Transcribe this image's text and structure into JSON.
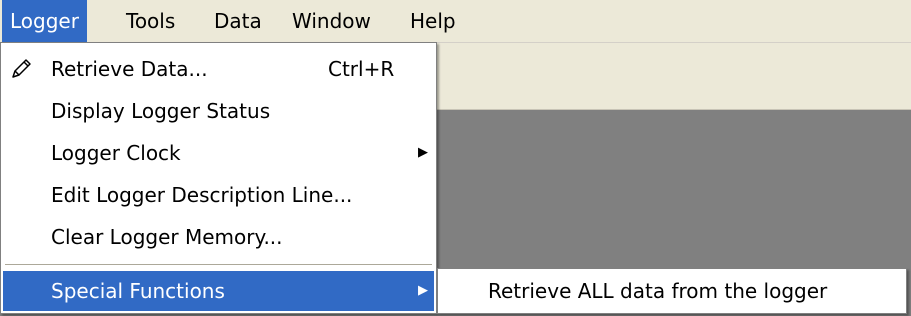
{
  "menubar": {
    "items": [
      {
        "label": "Logger",
        "active": true
      },
      {
        "label": "Tools"
      },
      {
        "label": "Data"
      },
      {
        "label": "Window"
      },
      {
        "label": "Help"
      }
    ]
  },
  "logger_menu": {
    "items": [
      {
        "label": "Retrieve Data...",
        "shortcut": "Ctrl+R",
        "icon": "pencil-icon"
      },
      {
        "label": "Display Logger Status"
      },
      {
        "label": "Logger Clock",
        "submenu": true
      },
      {
        "label": "Edit Logger Description Line..."
      },
      {
        "label": "Clear Logger Memory..."
      },
      {
        "label": "Special Functions",
        "submenu": true,
        "highlighted": true
      }
    ]
  },
  "special_functions_submenu": {
    "items": [
      {
        "label": "Retrieve ALL data from the logger"
      }
    ]
  },
  "colors": {
    "highlight": "#316ac5",
    "workspace": "#808080",
    "chrome": "#ece9d8"
  }
}
